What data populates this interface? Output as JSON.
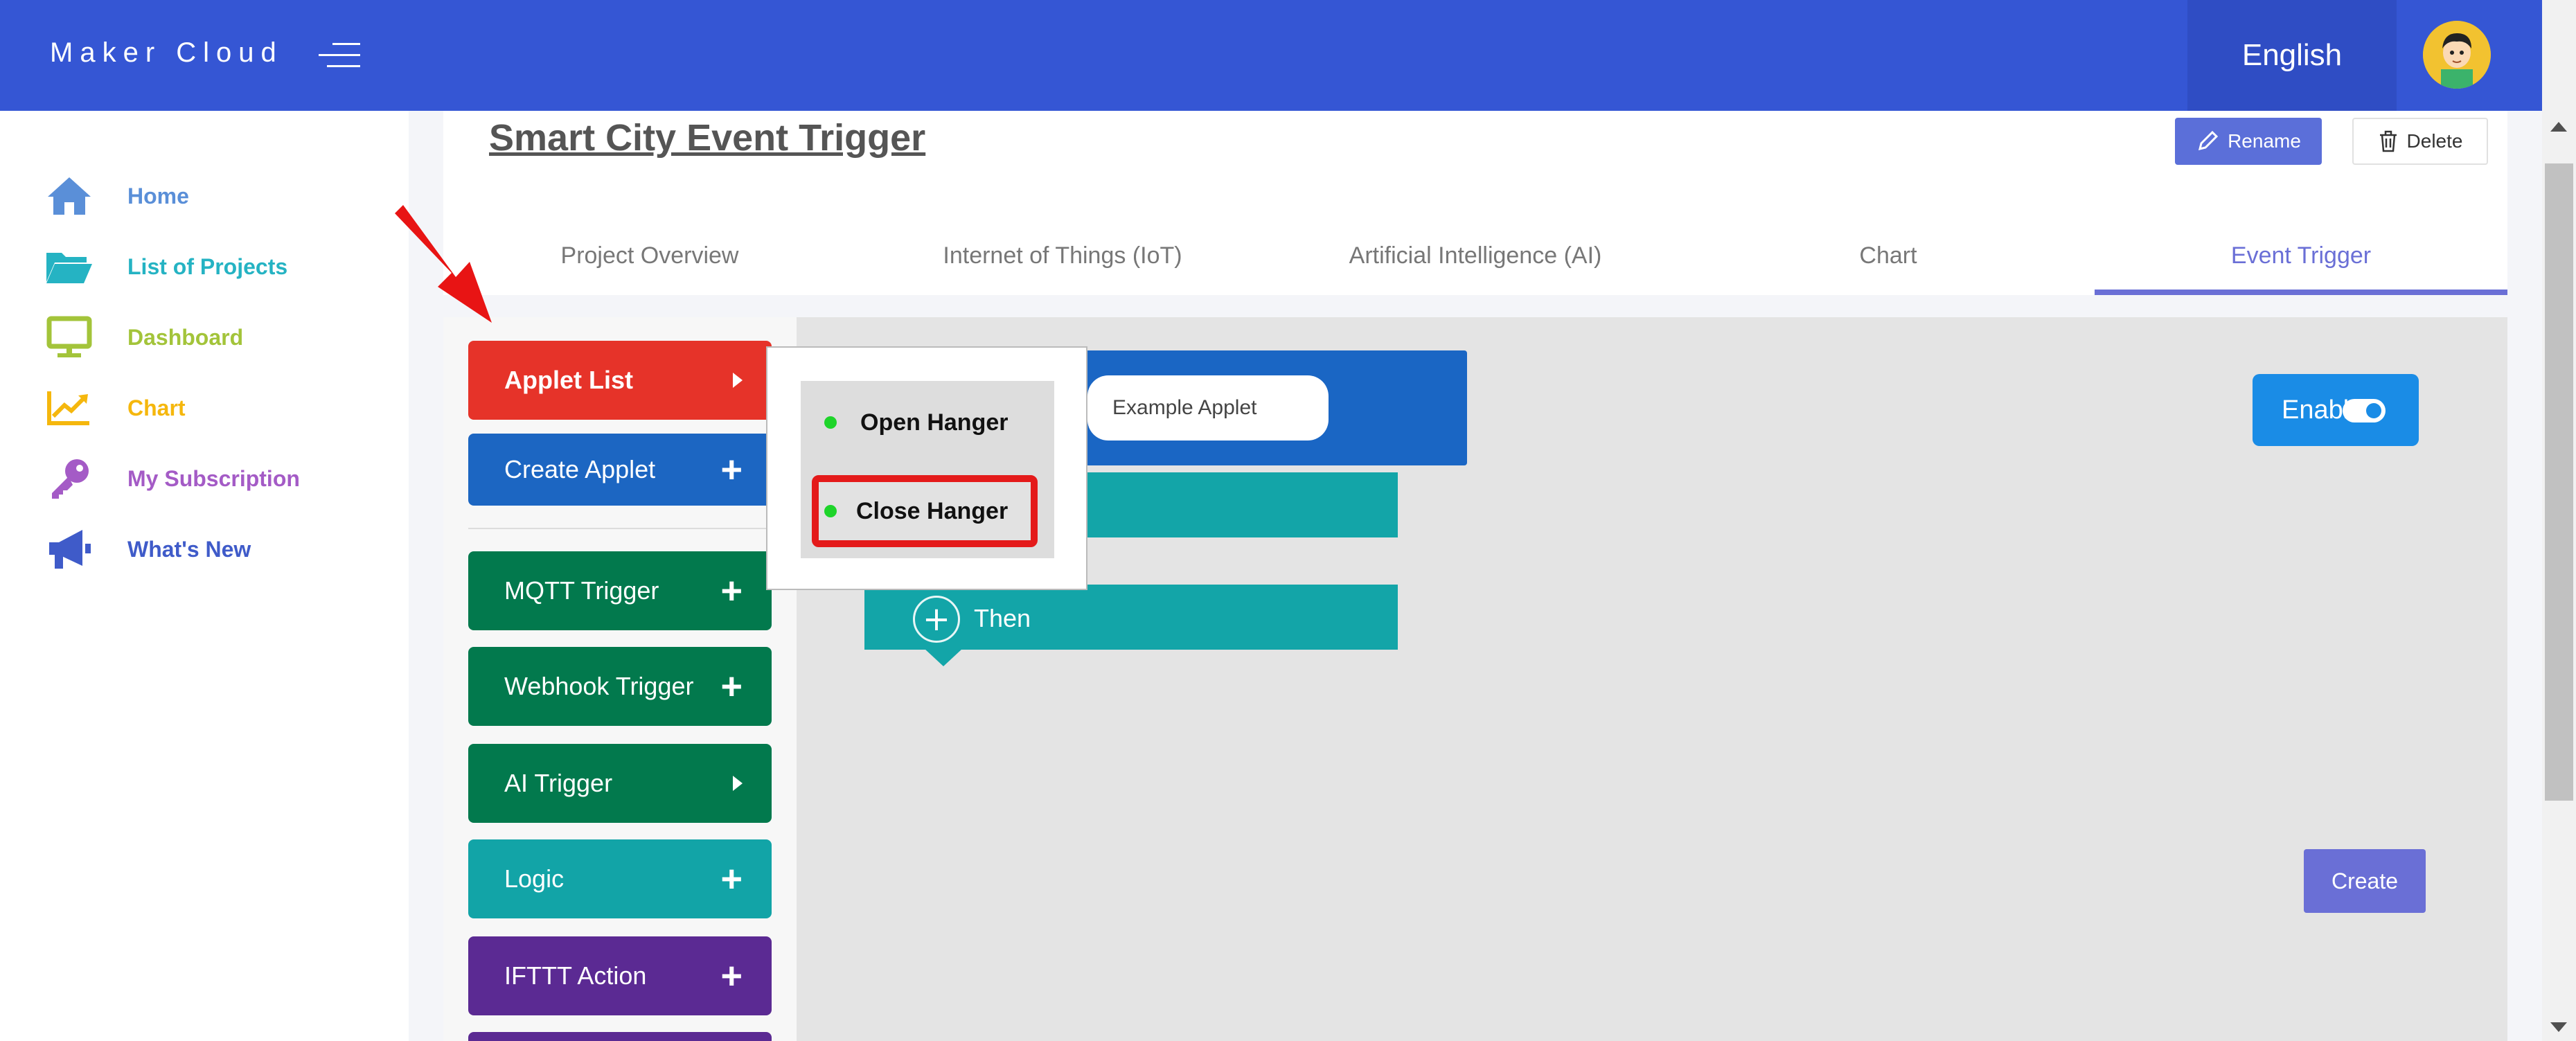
{
  "app": {
    "brand": "Maker Cloud",
    "language": "English"
  },
  "sidebar": {
    "items": [
      {
        "label": "Home",
        "icon": "home-icon",
        "color": "#5a8fd8"
      },
      {
        "label": "List of Projects",
        "icon": "folder-open-icon",
        "color": "#25b3c3"
      },
      {
        "label": "Dashboard",
        "icon": "monitor-icon",
        "color": "#a3c43a"
      },
      {
        "label": "Chart",
        "icon": "line-chart-icon",
        "color": "#f5b70d"
      },
      {
        "label": "My Subscription",
        "icon": "key-icon",
        "color": "#a45bc6"
      },
      {
        "label": "What's New",
        "icon": "megaphone-icon",
        "color": "#3f5bc9"
      }
    ]
  },
  "project": {
    "title": "Smart City Event Trigger",
    "rename_label": "Rename",
    "delete_label": "Delete"
  },
  "tabs": [
    {
      "label": "Project Overview",
      "active": false
    },
    {
      "label": "Internet of Things (IoT)",
      "active": false
    },
    {
      "label": "Artificial Intelligence (AI)",
      "active": false
    },
    {
      "label": "Chart",
      "active": false
    },
    {
      "label": "Event Trigger",
      "active": true
    }
  ],
  "palette": {
    "applet_list": "Applet List",
    "create_applet": "Create Applet",
    "mqtt_trigger": "MQTT Trigger",
    "webhook_trigger": "Webhook Trigger",
    "ai_trigger": "AI Trigger",
    "logic": "Logic",
    "ifttt_action": "IFTTT Action",
    "colors": {
      "applet_list": "#e63329",
      "create_applet": "#1c66c2",
      "trigger": "#02794d",
      "logic": "#12a4a7",
      "action": "#5b2a93"
    }
  },
  "hanger_menu": {
    "open": "Open Hanger",
    "close": "Close Hanger"
  },
  "canvas": {
    "applet_name": "Example Applet",
    "then_label": "Then",
    "enable_label": "Enable",
    "create_label": "Create"
  },
  "colors": {
    "topbar": "#3556d4",
    "accent": "#6a6fd6",
    "highlight": "#e41a1a"
  }
}
